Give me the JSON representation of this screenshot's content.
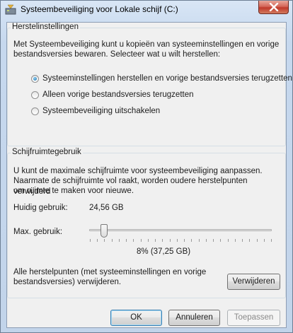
{
  "window": {
    "title": "Systeembeveiliging voor Lokale schijf (C:)"
  },
  "restore_settings": {
    "group_title": "Herstelinstellingen",
    "description_line1": "Met Systeembeveiliging kunt u kopieën van systeeminstellingen en vorige",
    "description_line2": "bestandsversies bewaren. Selecteer wat u wilt herstellen:",
    "options": [
      {
        "label": "Systeeminstellingen herstellen en vorige bestandsversies terugzetten",
        "checked": true
      },
      {
        "label": "Alleen vorige bestandsversies terugzetten",
        "checked": false
      },
      {
        "label": "Systeembeveiliging uitschakelen",
        "checked": false
      }
    ]
  },
  "disk_usage": {
    "group_title": "Schijfruimtegebruik",
    "description_line1": "U kunt de maximale schijfruimte voor systeembeveiliging aanpassen.",
    "description_line2": "Naarmate de schijfruimte vol raakt, worden oudere herstelpunten verwijderd",
    "description_line3": "om ruimte te maken voor nieuwe.",
    "current_usage_label": "Huidig gebruik:",
    "current_usage_value": "24,56 GB",
    "max_usage_label": "Max. gebruik:",
    "max_usage_value": "8% (37,25 GB)",
    "slider_percent": 8,
    "delete_text_line1": "Alle herstelpunten (met systeeminstellingen en vorige",
    "delete_text_line2": "bestandsversies) verwijderen.",
    "delete_button": "Verwijderen"
  },
  "buttons": {
    "ok": "OK",
    "cancel": "Annuleren",
    "apply": "Toepassen"
  },
  "colors": {
    "title_bar": "#cfdff2",
    "close_button": "#c0392b",
    "dialog_background": "#f0f0f0"
  }
}
